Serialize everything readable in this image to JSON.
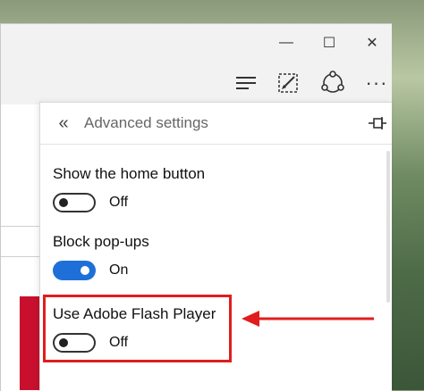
{
  "window": {
    "minimize_glyph": "—",
    "maximize_glyph": "☐",
    "close_glyph": "✕"
  },
  "toolbar": {
    "icons": [
      "hub-icon",
      "web-note-icon",
      "share-icon",
      "more-icon"
    ],
    "more_glyph": "···"
  },
  "panel": {
    "back_glyph": "«",
    "title": "Advanced settings"
  },
  "settings": [
    {
      "label": "Show the home button",
      "state": "Off"
    },
    {
      "label": "Block pop-ups",
      "state": "On"
    },
    {
      "label": "Use Adobe Flash Player",
      "state": "Off"
    }
  ],
  "colors": {
    "accent": "#1e6fd8",
    "highlight": "#e11d1d",
    "side_block": "#c8102e"
  }
}
